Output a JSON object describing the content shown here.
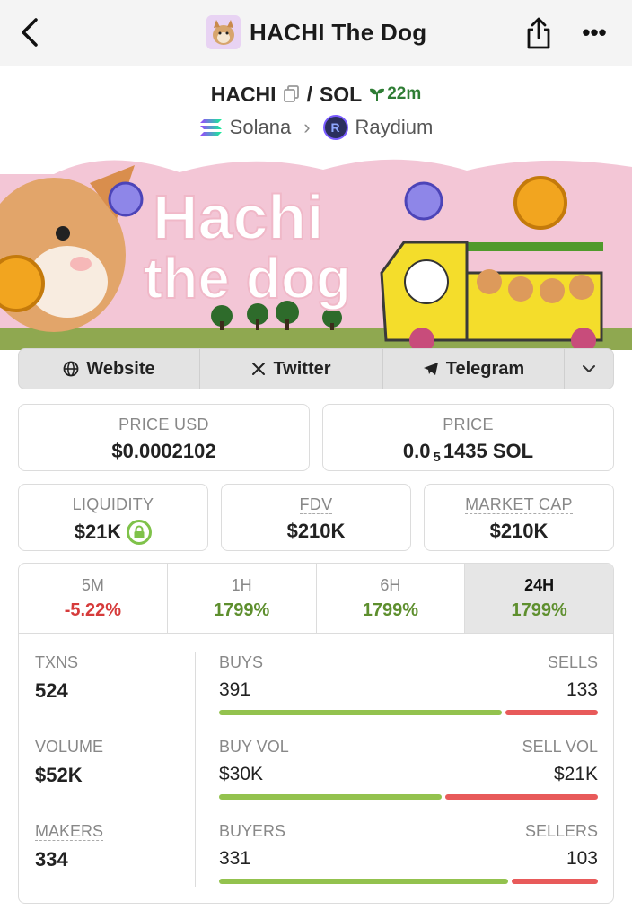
{
  "nav": {
    "title": "HACHI The Dog",
    "back_icon": "chevron-left-icon",
    "share_icon": "share-icon",
    "more_icon": "more-horizontal-icon",
    "more_glyph": "•••"
  },
  "pair": {
    "base": "HACHI",
    "separator": "/",
    "quote": "SOL",
    "age": "22m",
    "chain": "Solana",
    "chevron": "›",
    "dex": "Raydium",
    "dex_logo_letter": "R"
  },
  "banner": {
    "title_line1": "Hachi",
    "title_line2": "the dog"
  },
  "links": {
    "website": "Website",
    "twitter": "Twitter",
    "telegram": "Telegram"
  },
  "stats": {
    "price_usd_label": "PRICE USD",
    "price_usd": "$0.0002102",
    "price_label": "PRICE",
    "price_prefix": "0.0",
    "price_sub": "5",
    "price_suffix": "1435 SOL",
    "liquidity_label": "LIQUIDITY",
    "liquidity": "$21K",
    "fdv_label": "FDV",
    "fdv": "$210K",
    "mcap_label": "MARKET CAP",
    "mcap": "$210K"
  },
  "tabs": [
    {
      "label": "5M",
      "value": "-5.22%"
    },
    {
      "label": "1H",
      "value": "1799%"
    },
    {
      "label": "6H",
      "value": "1799%"
    },
    {
      "label": "24H",
      "value": "1799%"
    }
  ],
  "txns": {
    "txns_label": "TXNS",
    "txns": "524",
    "volume_label": "VOLUME",
    "volume": "$52K",
    "makers_label": "MAKERS",
    "makers": "334",
    "buys_label": "BUYS",
    "buys": "391",
    "sells_label": "SELLS",
    "sells": "133",
    "buyvol_label": "BUY VOL",
    "buyvol": "$30K",
    "sellvol_label": "SELL VOL",
    "sellvol": "$21K",
    "buyers_label": "BUYERS",
    "buyers": "331",
    "sellers_label": "SELLERS",
    "sellers": "103"
  },
  "bars": {
    "buys_fraction": 0.746,
    "buyvol_fraction": 0.588,
    "buyers_fraction": 0.763
  },
  "colors": {
    "positive": "#5e8f2e",
    "negative": "#d63b3b",
    "age": "#2f7d35"
  }
}
